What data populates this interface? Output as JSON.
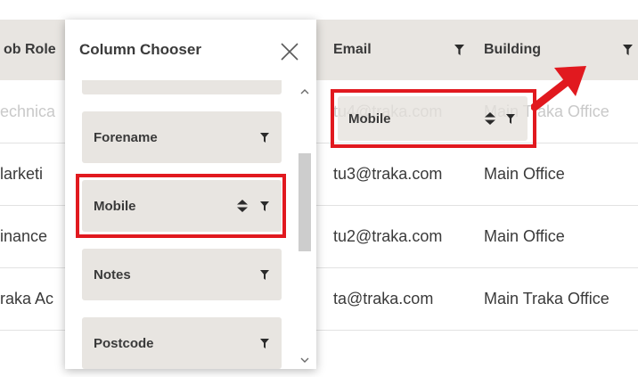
{
  "grid": {
    "headers": {
      "job_role": "ob Role",
      "email": "Email",
      "building": "Building"
    },
    "rows": [
      {
        "job_role": "echnica",
        "email": "tu4@traka.com",
        "building": "Main Traka Office"
      },
      {
        "job_role": "larketi",
        "email": "tu3@traka.com",
        "building": "Main Office"
      },
      {
        "job_role": "inance",
        "email": "tu2@traka.com",
        "building": "Main Office"
      },
      {
        "job_role": "raka Ac",
        "email": "ta@traka.com",
        "building": "Main Traka Office"
      }
    ]
  },
  "drag_ghost": {
    "label": "Mobile"
  },
  "column_chooser": {
    "title": "Column Chooser",
    "items": [
      {
        "label": ""
      },
      {
        "label": "Forename"
      },
      {
        "label": "Mobile"
      },
      {
        "label": "Notes"
      },
      {
        "label": "Postcode"
      }
    ]
  },
  "colors": {
    "highlight": "#e1191f",
    "header_bg": "#e8e5e1",
    "item_bg": "#e8e5e1"
  },
  "icons": {
    "filter": "filter-icon",
    "sort": "sort-icon",
    "close": "close-icon",
    "arrow": "red-arrow-annotation"
  }
}
